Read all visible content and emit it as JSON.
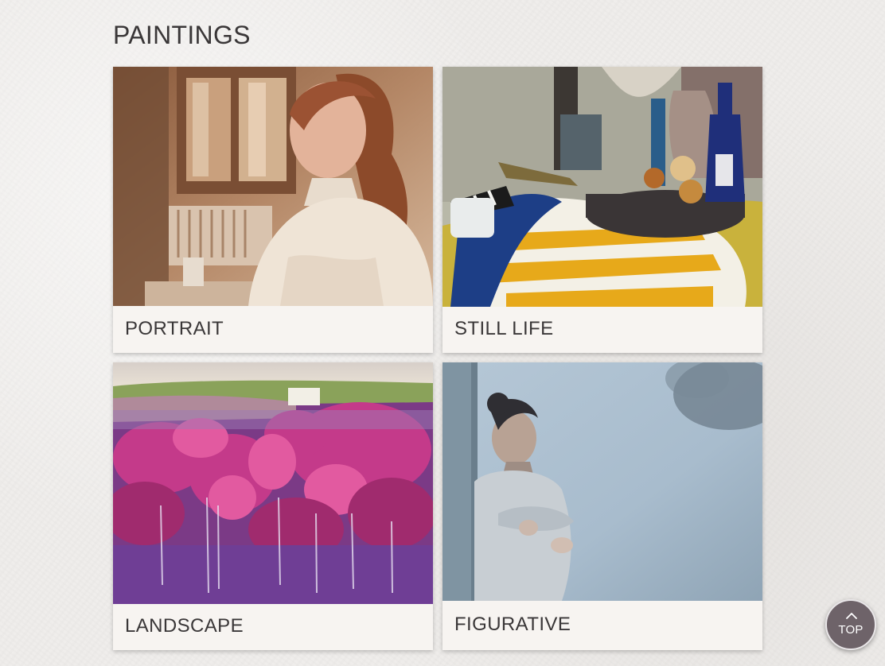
{
  "header": {
    "title": "PAINTINGS"
  },
  "cards": [
    {
      "label": "PORTRAIT",
      "image": "portrait-painting"
    },
    {
      "label": "STILL LIFE",
      "image": "still-life-painting"
    },
    {
      "label": "LANDSCAPE",
      "image": "landscape-painting"
    },
    {
      "label": "FIGURATIVE",
      "image": "figurative-painting"
    }
  ],
  "scroll_top": {
    "label": "TOP",
    "icon": "chevron-up-icon"
  },
  "colors": {
    "background": "#efedeb",
    "card_background": "#f7f4f1",
    "text": "#3a3738",
    "top_button": "#6e6369"
  }
}
